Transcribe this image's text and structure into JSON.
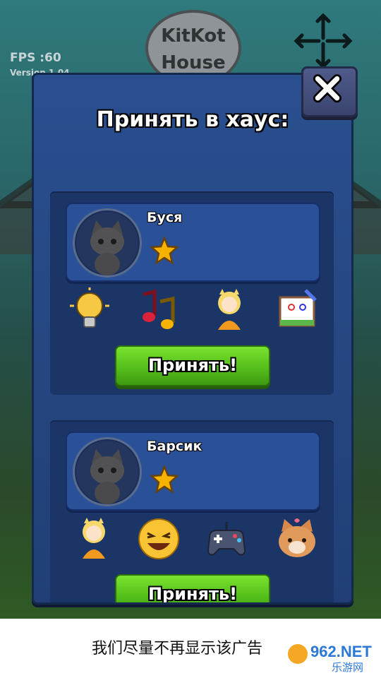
{
  "hud": {
    "fps": "FPS :60",
    "version": "Version 1.04"
  },
  "sign": {
    "line1": "KitKot",
    "line2": "House"
  },
  "dialog": {
    "title": "Принять в хаус:",
    "close_icon": "close-x-icon",
    "candidates": [
      {
        "name": "Буся",
        "stars": 1,
        "interests": [
          "lightbulb-icon",
          "music-notes-icon",
          "girl-doll-icon",
          "drawing-icon"
        ],
        "accept_label": "Принять!"
      },
      {
        "name": "Барсик",
        "stars": 1,
        "interests": [
          "girl-doll-icon",
          "laughing-emoji-icon",
          "gamepad-icon",
          "cat-face-icon"
        ],
        "accept_label": "Принять!"
      }
    ]
  },
  "ad": {
    "text": "我们尽量不再显示该广告",
    "watermark_main": "962.NET",
    "watermark_sub": "乐游网"
  },
  "colors": {
    "panel": "#2a4f8f",
    "button_green": "#55bf1b",
    "star": "#f5b300"
  }
}
